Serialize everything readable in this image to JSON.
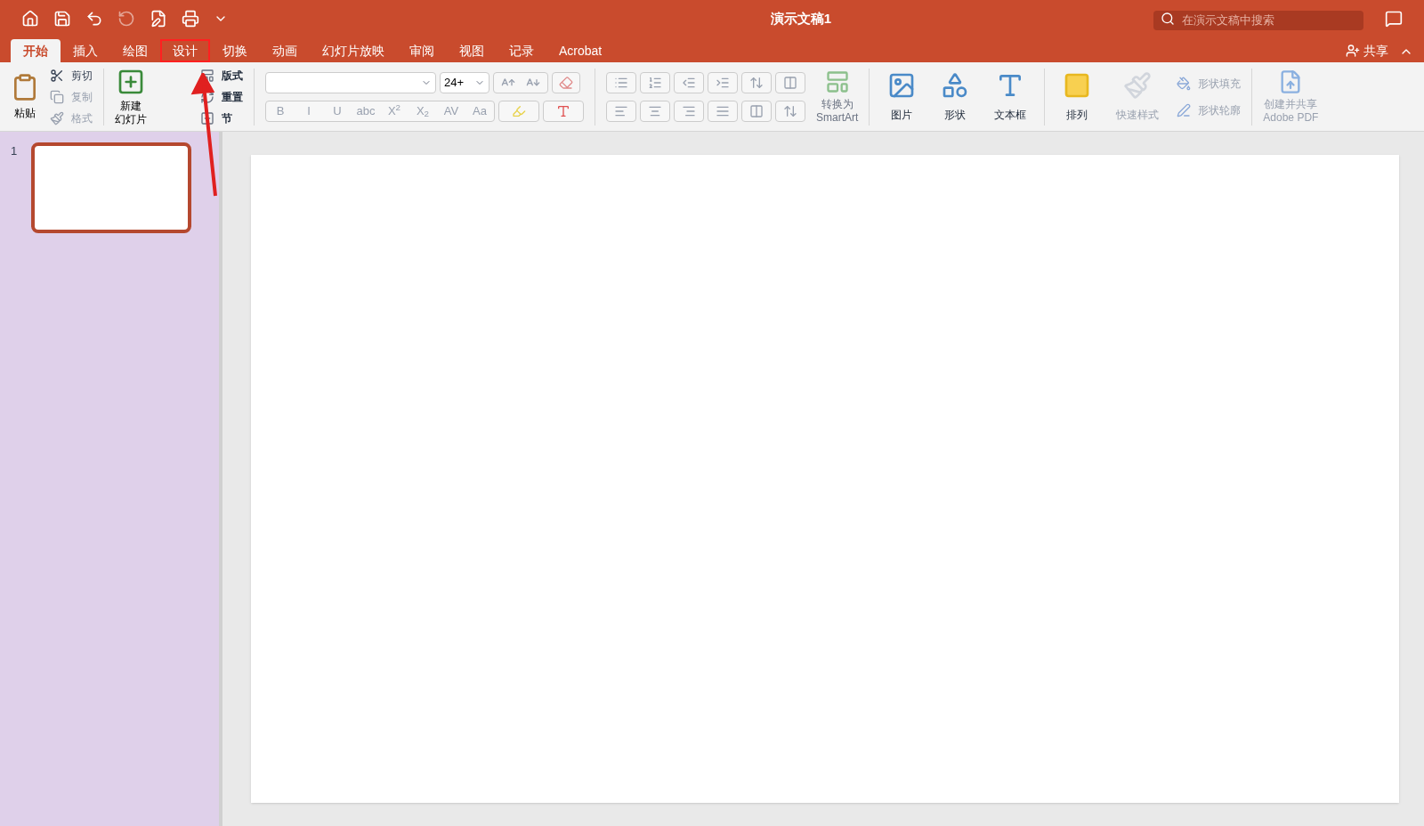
{
  "title": "演示文稿1",
  "search": {
    "placeholder": "在演示文稿中搜索"
  },
  "share": "共享",
  "tabs": [
    {
      "label": "开始",
      "selected": true,
      "highlighted": false
    },
    {
      "label": "插入",
      "selected": false,
      "highlighted": false
    },
    {
      "label": "绘图",
      "selected": false,
      "highlighted": false
    },
    {
      "label": "设计",
      "selected": false,
      "highlighted": true
    },
    {
      "label": "切换",
      "selected": false,
      "highlighted": false
    },
    {
      "label": "动画",
      "selected": false,
      "highlighted": false
    },
    {
      "label": "幻灯片放映",
      "selected": false,
      "highlighted": false
    },
    {
      "label": "审阅",
      "selected": false,
      "highlighted": false
    },
    {
      "label": "视图",
      "selected": false,
      "highlighted": false
    },
    {
      "label": "记录",
      "selected": false,
      "highlighted": false
    },
    {
      "label": "Acrobat",
      "selected": false,
      "highlighted": false
    }
  ],
  "clipboard": {
    "paste": "粘贴",
    "items": [
      {
        "label": "剪切",
        "disabled": false
      },
      {
        "label": "复制",
        "disabled": true
      },
      {
        "label": "格式",
        "disabled": true
      }
    ]
  },
  "slides_group": {
    "new_slide": [
      "新建",
      "幻灯片"
    ],
    "items": [
      {
        "label": "版式"
      },
      {
        "label": "重置"
      },
      {
        "label": "节"
      }
    ]
  },
  "font": {
    "size": "24+",
    "format_buttons": [
      "B",
      "I",
      "U",
      "abc",
      "X$^{2}$",
      "X$_{2}$",
      "AV",
      "Aa"
    ]
  },
  "smartart": [
    "转换为",
    "SmartArt"
  ],
  "insert": [
    "图片",
    "形状",
    "文本框"
  ],
  "arrange": "排列",
  "quick_styles": {
    "label": "快速样式",
    "disabled": true
  },
  "shape_items": [
    {
      "label": "形状填充",
      "disabled": true
    },
    {
      "label": "形状轮廓",
      "disabled": true
    }
  ],
  "adobe": [
    "创建并共享",
    "Adobe PDF"
  ],
  "slides": [
    {
      "number": "1",
      "selected": true
    }
  ]
}
